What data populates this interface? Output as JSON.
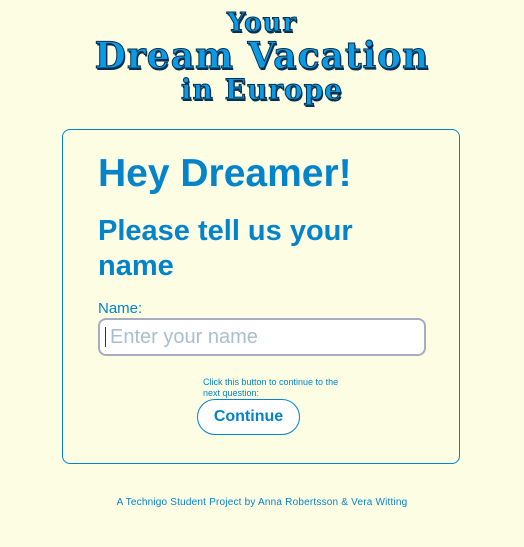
{
  "header": {
    "line1": "Your",
    "line2": "Dream Vacation",
    "line3": "in Europe"
  },
  "form": {
    "greeting": "Hey Dreamer!",
    "question": "Please tell us your name",
    "name_label": "Name:",
    "name_placeholder": "Enter your name",
    "name_value": "",
    "hint": "Click this button to continue to the next question:",
    "continue_label": "Continue"
  },
  "footer": {
    "text": "A Technigo Student Project by Anna Robertsson & Vera Witting"
  },
  "colors": {
    "background": "#fdfde3",
    "accent": "#0383c9",
    "title_fill": "#0b9ae6",
    "title_outline": "#04304e"
  }
}
